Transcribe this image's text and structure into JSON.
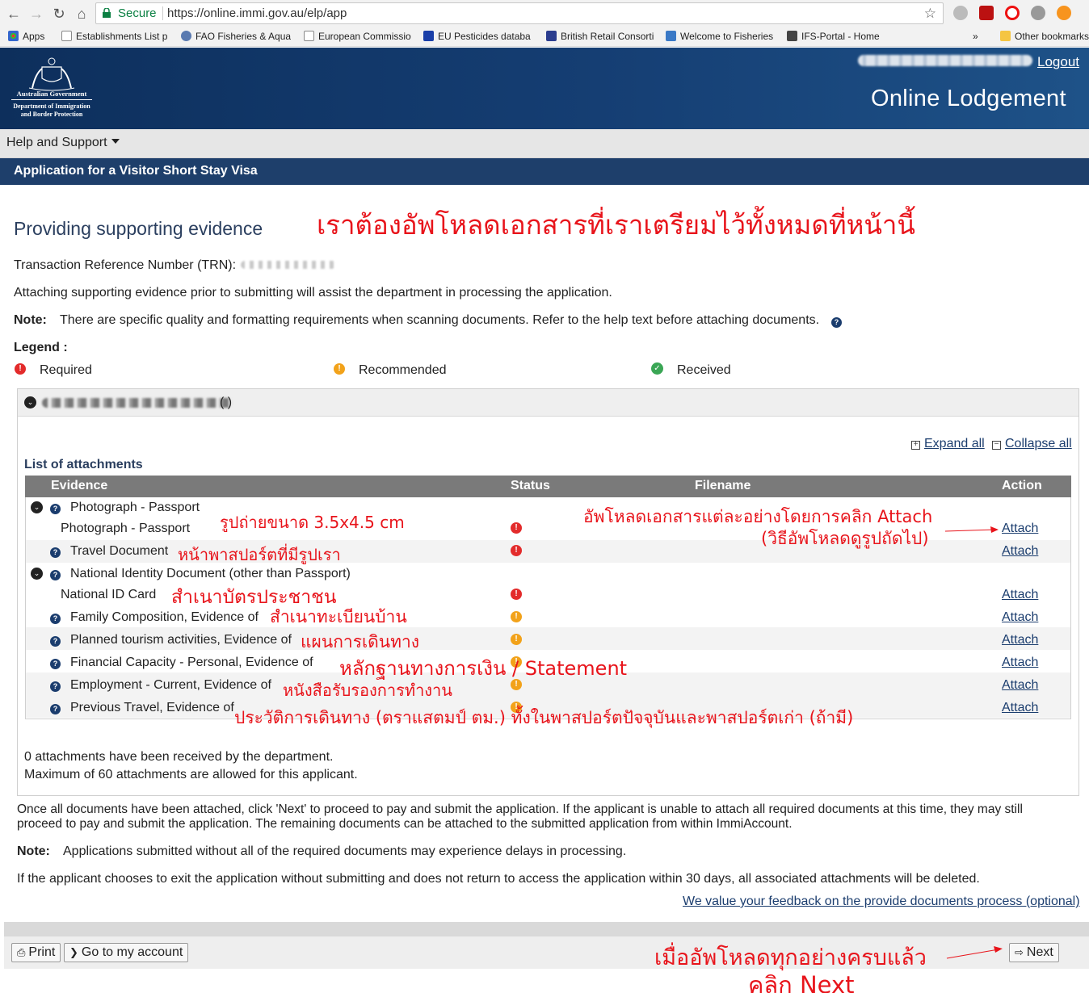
{
  "browser": {
    "secure_label": "Secure",
    "url": "https://online.immi.gov.au/elp/app",
    "bookmarks": [
      "Apps",
      "Establishments List p",
      "FAO Fisheries & Aqua",
      "European Commissio",
      "EU Pesticides databa",
      "British Retail Consorti",
      "Welcome to Fisheries",
      "IFS-Portal - Home"
    ],
    "more_bookmarks": "»",
    "other_bookmarks": "Other bookmarks"
  },
  "header": {
    "gov_name": "Australian Government",
    "dept_line1": "Department of Immigration",
    "dept_line2": "and Border Protection",
    "logout": "Logout",
    "site_title": "Online Lodgement"
  },
  "menu": {
    "help": "Help and Support"
  },
  "app_title": "Application for a Visitor Short Stay Visa",
  "page": {
    "heading": "Providing supporting evidence",
    "trn_label": "Transaction Reference Number (TRN):",
    "intro": "Attaching supporting evidence prior to submitting will assist the department in processing the application.",
    "note_label": "Note:",
    "note_text": "There are specific quality and formatting requirements when scanning documents. Refer to the help text before attaching documents.",
    "legend_label": "Legend :",
    "legend": {
      "required": "Required",
      "recommended": "Recommended",
      "received": "Received"
    }
  },
  "panel": {
    "applicant_suffix": "(                )",
    "expand_all": "Expand all",
    "collapse_all": "Collapse all",
    "list_title": "List of attachments",
    "columns": {
      "evidence": "Evidence",
      "status": "Status",
      "filename": "Filename",
      "action": "Action"
    },
    "rows": [
      {
        "group": "Photograph - Passport",
        "sub": "Photograph - Passport",
        "action": "Attach"
      },
      {
        "item": "Travel Document",
        "action": "Attach"
      },
      {
        "group": "National Identity Document (other than Passport)",
        "sub": "National ID Card",
        "action": "Attach"
      },
      {
        "item": "Family Composition, Evidence of",
        "action": "Attach"
      },
      {
        "item": "Planned tourism activities, Evidence of",
        "action": "Attach"
      },
      {
        "item": "Financial Capacity - Personal, Evidence of",
        "action": "Attach"
      },
      {
        "item": "Employment - Current, Evidence of",
        "action": "Attach"
      },
      {
        "item": "Previous Travel, Evidence of",
        "action": "Attach"
      }
    ],
    "received_count": "0 attachments have been received by the department.",
    "max_count": "Maximum of 60 attachments are allowed for this applicant."
  },
  "bottom": {
    "para1_line1": "Once all documents have been attached, click 'Next' to proceed to pay and submit the application. If the applicant is unable to attach all required documents at this time, they may still",
    "para1_line2": "proceed to pay and submit the application. The remaining documents can be attached to the submitted application from within ImmiAccount.",
    "note_label": "Note:",
    "note_text": "Applications submitted without all of the required documents may experience delays in processing.",
    "para2": "If the applicant chooses to exit the application without submitting and does not return to access the application within 30 days, all associated attachments will be deleted.",
    "feedback_link": "We value your feedback on the provide documents process (optional)"
  },
  "buttons": {
    "print": "Print",
    "account": "Go to my account",
    "next": "Next"
  },
  "annotations": {
    "top": "เราต้องอัพโหลดเอกสารที่เราเตรียมไว้ทั้งหมดที่หน้านี้",
    "photo": "รูปถ่ายขนาด 3.5x4.5 cm",
    "attach_line1": "อัพโหลดเอกสารแต่ละอย่างโดยการคลิก Attach",
    "attach_line2": "(วิธีอัพโหลดดูรูปถัดไป)",
    "travel_doc": "หน้าพาสปอร์ตที่มีรูปเรา",
    "id_card": "สำเนาบัตรประชาชน",
    "family": "สำเนาทะเบียนบ้าน",
    "tourism": "แผนการเดินทาง",
    "financial": "หลักฐานทางการเงิน / Statement",
    "employment": "หนังสือรับรองการทำงาน",
    "prev_travel": "ประวัติการเดินทาง (ตราแสตมป์ ตม.) ทั้งในพาสปอร์ตปัจจุบันและพาสปอร์ตเก่า (ถ้ามี)",
    "next_line1": "เมื่ออัพโหลดทุกอย่างครบแล้ว",
    "next_line2": "คลิก Next"
  },
  "colors": {
    "header_blue": "#153e73",
    "app_bar": "#1e3f6b",
    "annotation_red": "#e8141b",
    "link_blue": "#1b3d6e"
  }
}
